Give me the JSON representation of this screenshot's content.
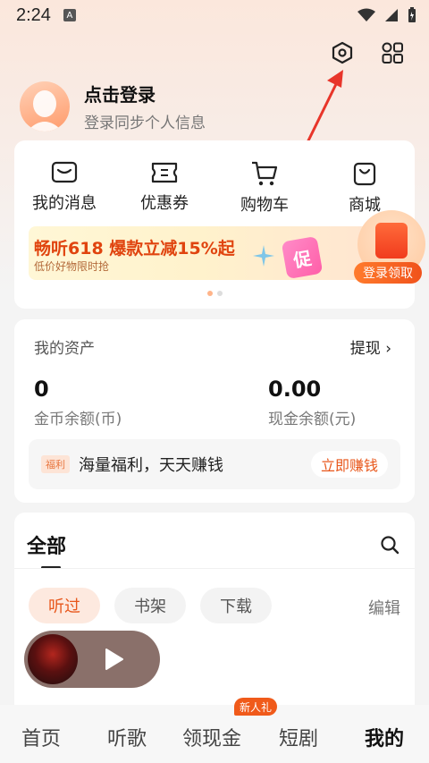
{
  "status_bar": {
    "time": "2:24",
    "notif_badge": "A"
  },
  "header": {
    "settings_icon": "settings-hexagon-icon",
    "apps_icon": "grid-apps-icon"
  },
  "profile": {
    "title": "点击登录",
    "subtitle": "登录同步个人信息"
  },
  "quick_actions": [
    {
      "label": "我的消息",
      "icon": "message-icon"
    },
    {
      "label": "优惠券",
      "icon": "coupon-icon"
    },
    {
      "label": "购物车",
      "icon": "cart-icon"
    },
    {
      "label": "商城",
      "icon": "shop-bag-icon"
    }
  ],
  "banner": {
    "title": "畅听618 爆款立减15%起",
    "subtitle": "低价好物限时抢",
    "promo_tag": "促",
    "claim_label": "登录领取"
  },
  "assets": {
    "title": "我的资产",
    "withdraw_label": "提现 ›",
    "coin_value": "0",
    "coin_label": "金币余额(币)",
    "cash_value": "0.00",
    "cash_label": "现金余额(元)",
    "welfare_tag": "福利",
    "welfare_text": "海量福利，天天赚钱",
    "earn_label": "立即赚钱"
  },
  "library": {
    "tab_all": "全部",
    "chips": [
      "听过",
      "书架",
      "下载"
    ],
    "edit_label": "编辑"
  },
  "bottom_nav": {
    "items": [
      "首页",
      "听歌",
      "领现金",
      "短剧",
      "我的"
    ],
    "new_badge": "新人礼"
  },
  "colors": {
    "accent": "#e8571b",
    "brand_orange": "#ff7b2d"
  }
}
